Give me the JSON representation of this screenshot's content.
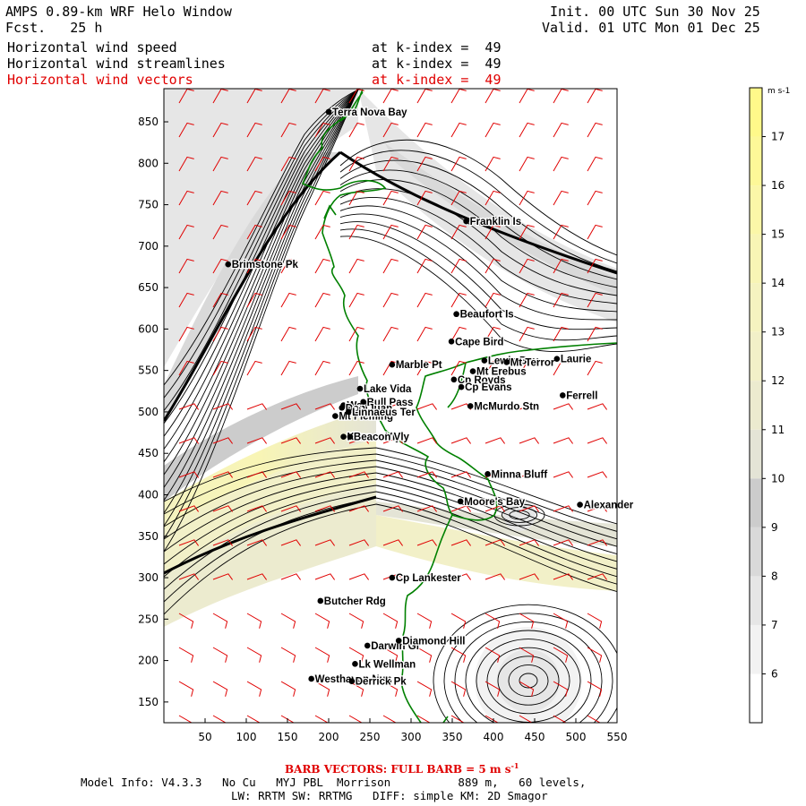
{
  "header": {
    "title": "AMPS 0.89-km WRF Helo Window",
    "fcst_label": "Fcst.",
    "fcst_value": "25 h",
    "init": "Init. 00 UTC Sun 30 Nov 25",
    "valid": "Valid. 01 UTC Mon 01 Dec 25",
    "fields": [
      {
        "name": "Horizontal wind speed",
        "level": "at k-index =  49",
        "color": "#000000"
      },
      {
        "name": "Horizontal wind streamlines",
        "level": "at k-index =  49",
        "color": "#000000"
      },
      {
        "name": "Horizontal wind vectors",
        "level": "at k-index =  49",
        "color": "#e00000"
      }
    ]
  },
  "axes": {
    "x_ticks": [
      "50",
      "100",
      "150",
      "200",
      "250",
      "300",
      "350",
      "400",
      "450",
      "500",
      "550"
    ],
    "y_ticks": [
      "150",
      "200",
      "250",
      "300",
      "350",
      "400",
      "450",
      "500",
      "550",
      "600",
      "650",
      "700",
      "750",
      "800",
      "850"
    ],
    "x_range": [
      0,
      550
    ],
    "y_range": [
      125,
      890
    ]
  },
  "colorbar": {
    "unit": "m s-1",
    "labels": [
      "6",
      "7",
      "8",
      "9",
      "10",
      "11",
      "12",
      "13",
      "14",
      "15",
      "16",
      "17"
    ],
    "bins": [
      {
        "from": 5,
        "to": 6,
        "color": "#ffffff"
      },
      {
        "from": 6,
        "to": 7,
        "color": "#f2f2f2"
      },
      {
        "from": 7,
        "to": 8,
        "color": "#e6e6e6"
      },
      {
        "from": 8,
        "to": 9,
        "color": "#d9d9d9"
      },
      {
        "from": 9,
        "to": 10,
        "color": "#cccccc"
      },
      {
        "from": 10,
        "to": 11,
        "color": "#e4e4d6"
      },
      {
        "from": 11,
        "to": 12,
        "color": "#ecebcf"
      },
      {
        "from": 12,
        "to": 13,
        "color": "#f2f0c8"
      },
      {
        "from": 13,
        "to": 14,
        "color": "#f5f3c0"
      },
      {
        "from": 14,
        "to": 15,
        "color": "#f8f5b5"
      },
      {
        "from": 15,
        "to": 16,
        "color": "#fbf7a8"
      },
      {
        "from": 16,
        "to": 17,
        "color": "#fdf898"
      },
      {
        "from": 17,
        "to": 18,
        "color": "#fff98a"
      }
    ]
  },
  "places": [
    {
      "name": "Terra Nova Bay",
      "x": 200,
      "y": 862
    },
    {
      "name": "Franklin Is",
      "x": 367,
      "y": 730
    },
    {
      "name": "Brimstone Pk",
      "x": 78,
      "y": 678
    },
    {
      "name": "Beaufort Is",
      "x": 355,
      "y": 618
    },
    {
      "name": "Cape Bird",
      "x": 349,
      "y": 585
    },
    {
      "name": "Marble Pt",
      "x": 277,
      "y": 557
    },
    {
      "name": "Lewis Bay",
      "x": 389,
      "y": 562
    },
    {
      "name": "Mt Terror",
      "x": 416,
      "y": 560
    },
    {
      "name": "Laurie",
      "x": 477,
      "y": 564
    },
    {
      "name": "Cp Royds",
      "x": 352,
      "y": 539
    },
    {
      "name": "Mt Erebus",
      "x": 375,
      "y": 549
    },
    {
      "name": "Lake Vida",
      "x": 238,
      "y": 528
    },
    {
      "name": "Cp Evans",
      "x": 361,
      "y": 530
    },
    {
      "name": "Ferrell",
      "x": 484,
      "y": 520
    },
    {
      "name": "Wall Vly",
      "x": 218,
      "y": 508
    },
    {
      "name": "Bull Pass",
      "x": 242,
      "y": 512
    },
    {
      "name": "McMurdo Stn",
      "x": 372,
      "y": 507
    },
    {
      "name": "Don Juan",
      "x": 216,
      "y": 505
    },
    {
      "name": "Mt Fleming",
      "x": 208,
      "y": 495
    },
    {
      "name": "Linnaeus Ter",
      "x": 224,
      "y": 500
    },
    {
      "name": "Kennar Vly",
      "x": 218,
      "y": 470
    },
    {
      "name": "Beacon Vly",
      "x": 226,
      "y": 470
    },
    {
      "name": "Minna Bluff",
      "x": 393,
      "y": 425
    },
    {
      "name": "Moore's Bay",
      "x": 360,
      "y": 392
    },
    {
      "name": "Alexander",
      "x": 505,
      "y": 388
    },
    {
      "name": "Cp Lankester",
      "x": 277,
      "y": 300
    },
    {
      "name": "Butcher Rdg",
      "x": 190,
      "y": 272
    },
    {
      "name": "Darwin Gl",
      "x": 247,
      "y": 218
    },
    {
      "name": "Diamond Hill",
      "x": 285,
      "y": 224
    },
    {
      "name": "Lk Wellman",
      "x": 232,
      "y": 196
    },
    {
      "name": "Westhaven Nun",
      "x": 179,
      "y": 178
    },
    {
      "name": "Derrick Pk",
      "x": 228,
      "y": 175
    }
  ],
  "footer": {
    "barb_note": "BARB VECTORS:  FULL BARB = 5 m s",
    "barb_exp": "-1",
    "model_info": "Model Info: V4.3.3   No Cu   MYJ PBL  Morrison          889 m,   60 levels,",
    "physics": "LW: RRTM SW: RRTMG   DIFF: simple KM: 2D Smagor"
  },
  "colors": {
    "barb": "#e00000",
    "coast": "#008000",
    "streamline": "#000000"
  }
}
